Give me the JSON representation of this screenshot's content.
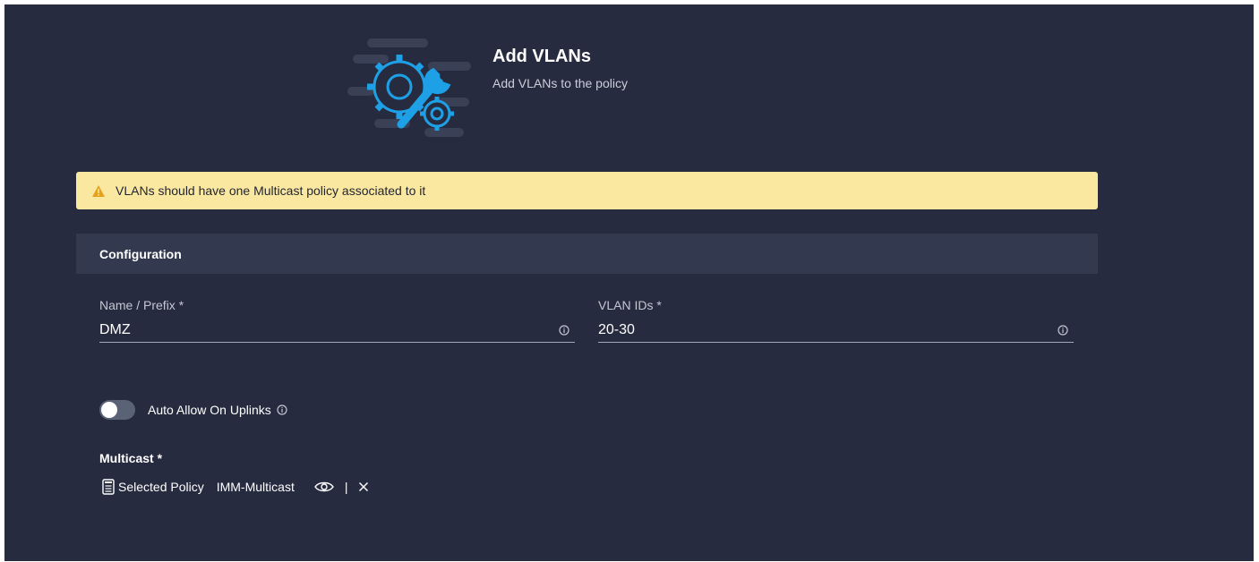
{
  "header": {
    "title": "Add VLANs",
    "subtitle": "Add VLANs to the policy",
    "icon": "gears-wrench-icon"
  },
  "alert": {
    "text": "VLANs should have one Multicast policy associated to it",
    "icon": "warning-icon",
    "color": "#fae8a0"
  },
  "section": {
    "title": "Configuration"
  },
  "form": {
    "name_label": "Name / Prefix *",
    "name_value": "DMZ",
    "vlan_label": "VLAN IDs *",
    "vlan_value": "20-30",
    "toggle_label": "Auto Allow On Uplinks",
    "toggle_on": false,
    "multicast_label": "Multicast *",
    "selected_policy_label": "Selected Policy",
    "selected_policy_name": "IMM-Multicast",
    "separator": "|"
  },
  "colors": {
    "background": "#272b3f",
    "section_header": "#333a50",
    "accent": "#1ea0e6"
  }
}
